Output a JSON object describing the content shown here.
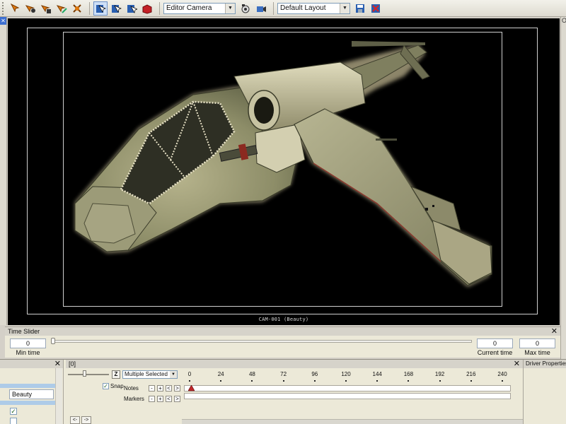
{
  "toolbar": {
    "camera_select": "Editor Camera",
    "layout_select": "Default Layout",
    "icons": [
      "move-tool-icon",
      "rotate-tool-icon",
      "scale-tool-icon",
      "orient-tool-icon",
      "snap-tool-icon",
      "select-mode-icon",
      "paint-select-icon",
      "lasso-select-icon",
      "material-icon",
      "camera-settings-icon",
      "camera-render-icon",
      "save-layout-icon",
      "reset-layout-icon"
    ]
  },
  "right_strip": {
    "header": "Ol"
  },
  "viewport": {
    "camera_label": "CAM-001 (Beauty)"
  },
  "time_slider": {
    "title": "Time Slider",
    "min_time_value": "0",
    "min_time_label": "Min time",
    "current_time_value": "0",
    "current_time_label": "Current time",
    "max_time_value": "0",
    "max_time_label": "Max time",
    "close_label": "✕"
  },
  "left_panel": {
    "close_label": "✕",
    "input_value": "Beauty",
    "checkbox_1_checked": "✓",
    "checkbox_2_checked": ""
  },
  "timeline": {
    "title": "[0]",
    "close_label": "✕",
    "z_label": "Z",
    "selection": "Multiple Selected",
    "snap_label": "Snap",
    "snap_checked": "✓",
    "notes_label": "Notes",
    "markers_label": "Markers",
    "ruler": [
      "0",
      "24",
      "48",
      "72",
      "96",
      "120",
      "144",
      "168",
      "192",
      "216",
      "240"
    ],
    "btn_minus": "-",
    "btn_plus": "+",
    "btn_prev": "<",
    "btn_next": ">",
    "nav_prev": "<-",
    "nav_next": "->"
  },
  "driver_properties": {
    "title": "Driver Properties"
  },
  "colors": {
    "accent": "#3d6fd1",
    "keyframe": "#c0282a",
    "panel": "#ece9d8"
  }
}
